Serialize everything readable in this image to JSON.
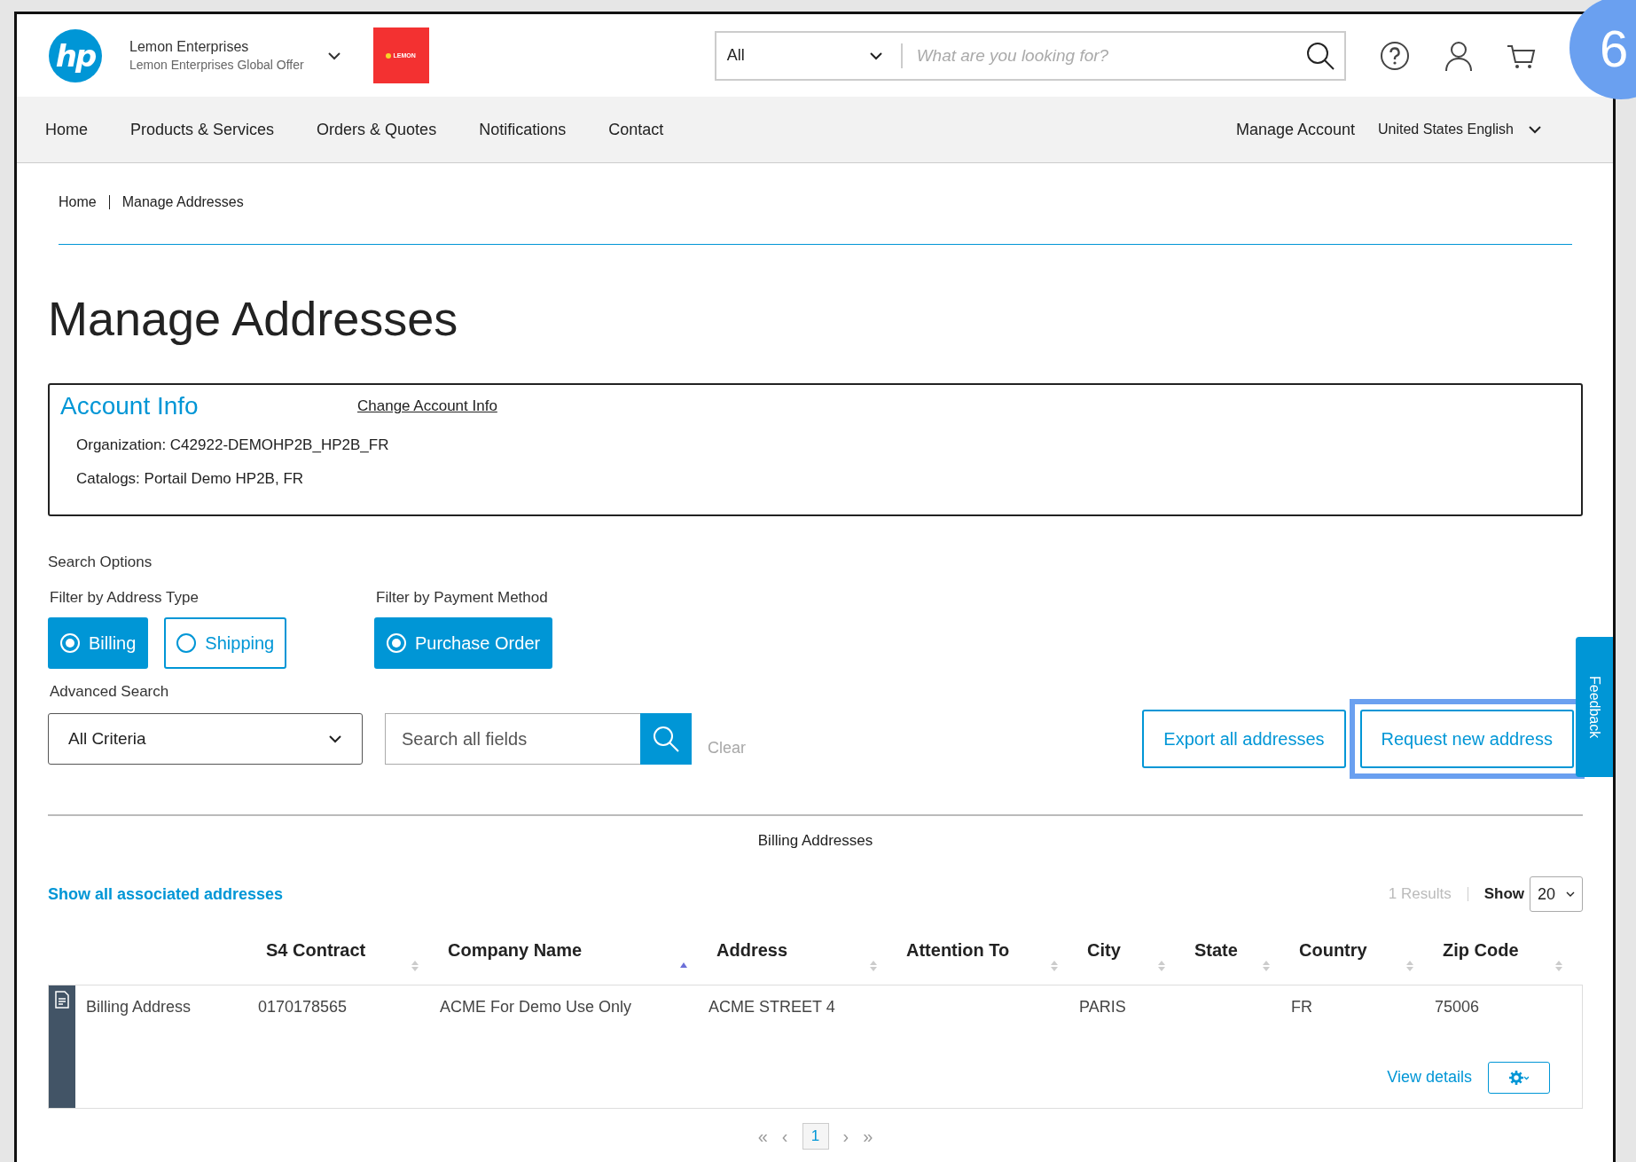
{
  "header": {
    "logo_text": "hp",
    "company": "Lemon Enterprises",
    "offer": "Lemon Enterprises Global Offer",
    "partner_logo_text": "LEMON",
    "search": {
      "category": "All",
      "placeholder": "What are you looking for?"
    }
  },
  "step_badge": "6",
  "nav": {
    "items": [
      "Home",
      "Products & Services",
      "Orders & Quotes",
      "Notifications",
      "Contact"
    ],
    "account": "Manage Account",
    "language": "United States English"
  },
  "breadcrumb": [
    "Home",
    "Manage Addresses"
  ],
  "title": "Manage Addresses",
  "account_info": {
    "heading": "Account Info",
    "link": "Change Account Info",
    "lines": [
      "Organization: C42922-DEMOHP2B_HP2B_FR",
      "Catalogs: Portail Demo HP2B, FR"
    ]
  },
  "search_options": {
    "heading": "Search Options",
    "filter_groups": [
      {
        "label": "Filter by Address Type",
        "options": [
          {
            "label": "Billing",
            "selected": true
          },
          {
            "label": "Shipping",
            "selected": false
          }
        ]
      },
      {
        "label": "Filter by Payment Method",
        "options": [
          {
            "label": "Purchase Order",
            "selected": true
          }
        ]
      }
    ],
    "advanced_label": "Advanced Search",
    "criteria": "All Criteria",
    "search_placeholder": "Search all fields",
    "clear": "Clear"
  },
  "actions": [
    {
      "label": "Export all addresses",
      "highlighted": false
    },
    {
      "label": "Request new address",
      "highlighted": true
    }
  ],
  "feedback": "Feedback",
  "section_title": "Billing Addresses",
  "show_all_link": "Show all associated addresses",
  "results": "1 Results",
  "show_label": "Show",
  "page_size": "20",
  "table": {
    "columns": [
      {
        "label": "S4 Contract",
        "sorted_ascending": false
      },
      {
        "label": "Company Name",
        "sorted_ascending": true
      },
      {
        "label": "Address",
        "sorted_ascending": false
      },
      {
        "label": "Attention To",
        "sorted_ascending": false
      },
      {
        "label": "City",
        "sorted_ascending": false
      },
      {
        "label": "State",
        "sorted_ascending": false
      },
      {
        "label": "Country",
        "sorted_ascending": false
      },
      {
        "label": "Zip Code",
        "sorted_ascending": false
      }
    ],
    "rows": [
      {
        "type": "Billing Address",
        "cells": [
          "0170178565",
          "ACME For Demo Use Only",
          "ACME STREET 4",
          null,
          "PARIS",
          null,
          "FR",
          "75006"
        ],
        "action": "View details"
      }
    ]
  },
  "pagination": {
    "first": "«",
    "prev": "‹",
    "pages": [
      {
        "label": "1",
        "selected": true
      }
    ],
    "next": "›",
    "last": "»"
  }
}
